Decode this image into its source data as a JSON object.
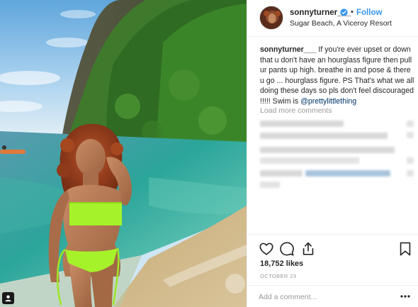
{
  "header": {
    "username": "sonnyturner___",
    "follow_label": "Follow",
    "separator": "•",
    "location": "Sugar Beach, A Viceroy Resort",
    "verified_icon": "verified-badge-icon",
    "verified_color": "#3897f0"
  },
  "caption": {
    "username": "sonnyturner___",
    "text": " If you're ever upset or down that u don't have an hourglass figure then pull ur pants up high. breathe in and pose & there u go ... hourglass figure. PS That's what we all doing these days so pls don't feel discouraged !!!!! Swim is ",
    "mention": "@prettylittlething"
  },
  "comments": {
    "load_more_label": "Load more comments"
  },
  "actions": {
    "like_icon": "heart-icon",
    "comment_icon": "comment-icon",
    "share_icon": "share-icon",
    "save_icon": "bookmark-icon"
  },
  "likes": {
    "label": "18,752 likes"
  },
  "date": {
    "label": "OCTOBER 23"
  },
  "comment_box": {
    "placeholder": "Add a comment...",
    "more_icon": "more-options-icon"
  },
  "colors": {
    "link_blue": "#3897f0",
    "mention_blue": "#003569",
    "muted_gray": "#999999",
    "text": "#262626",
    "bikini_neon": "#a6f22a"
  }
}
